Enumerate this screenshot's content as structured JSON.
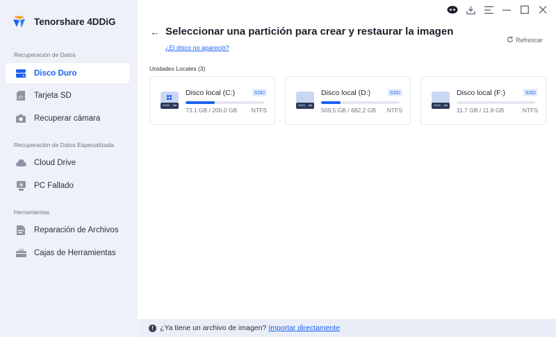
{
  "app": {
    "name": "Tenorshare 4DDiG"
  },
  "sidebar": {
    "sections": [
      {
        "title": "Recuperación de Datos"
      },
      {
        "title": "Recuperación de Datos Especializada"
      },
      {
        "title": "Herramientas"
      }
    ],
    "items": [
      {
        "label": "Disco Duro",
        "icon": "hard-drive-icon",
        "active": true
      },
      {
        "label": "Tarjeta SD",
        "icon": "sd-card-icon"
      },
      {
        "label": "Recuperar cámara",
        "icon": "camera-icon"
      },
      {
        "label": "Cloud Drive",
        "icon": "cloud-icon"
      },
      {
        "label": "PC Fallado",
        "icon": "crashed-pc-icon"
      },
      {
        "label": "Reparación de Archivos",
        "icon": "file-repair-icon"
      },
      {
        "label": "Cajas de Herramientas",
        "icon": "toolbox-icon"
      }
    ]
  },
  "window_controls": [
    "assistant-icon",
    "download-icon",
    "menu-icon",
    "minimize-icon",
    "maximize-icon",
    "close-icon"
  ],
  "header": {
    "title": "Seleccionar una partición para crear y restaurar la imagen",
    "disk_missing_link": "¿El disco no apareció?",
    "refresh_label": "Refrescar"
  },
  "drives": {
    "section_label": "Unidades Locales (3)",
    "items": [
      {
        "name": "Disco local (C:)",
        "badge": "SSD",
        "size": "73.1 GB / 200.0 GB",
        "fs": "NTFS",
        "used_fraction": 0.37,
        "system": true
      },
      {
        "name": "Disco local (D:)",
        "badge": "SSD",
        "size": "509,5 GB / 682,2 GB",
        "fs": "NTFS",
        "used_fraction": 0.25,
        "system": false
      },
      {
        "name": "Disco local (F:)",
        "badge": "SSD",
        "size": "11.7 GB / 11.8 GB",
        "fs": "NTFS",
        "used_fraction": 0.0,
        "system": false
      }
    ]
  },
  "footer": {
    "text": "¿Ya tiene un archivo de imagen?",
    "link": "Importar directamente"
  },
  "colors": {
    "accent": "#1d62f0",
    "sidebar_bg": "#eef1f8",
    "footer_bg": "#e9eef9"
  }
}
